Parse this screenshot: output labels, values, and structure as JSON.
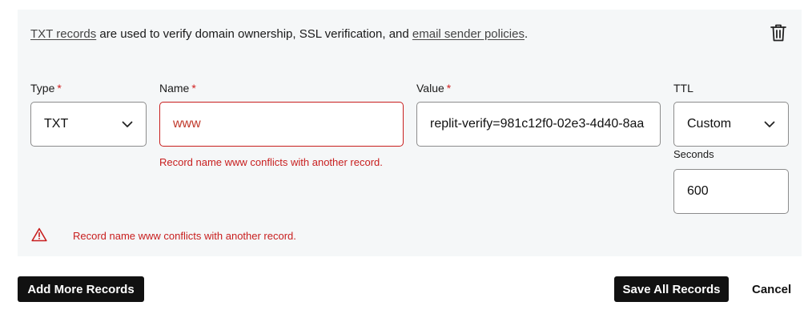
{
  "intro": {
    "link1": "TXT records",
    "middle": " are used to verify domain ownership, SSL verification, and ",
    "link2": "email sender policies",
    "end": "."
  },
  "icons": {
    "delete": "trash-icon",
    "select_arrow": "chevron-down-icon",
    "warning": "warning-triangle-icon"
  },
  "form": {
    "type": {
      "label": "Type",
      "required_mark": "*",
      "value": "TXT"
    },
    "name": {
      "label": "Name",
      "required_mark": "*",
      "value": "www",
      "error": "Record name www conflicts with another record."
    },
    "value": {
      "label": "Value",
      "required_mark": "*",
      "value": "replit-verify=981c12f0-02e3-4d40-8aa"
    },
    "ttl": {
      "label": "TTL",
      "value": "Custom"
    },
    "seconds": {
      "label": "Seconds",
      "value": "600"
    }
  },
  "form_error": "Record name www conflicts with another record.",
  "actions": {
    "add_more": "Add More Records",
    "save_all": "Save All Records",
    "cancel": "Cancel"
  },
  "colors": {
    "panel_bg": "#f5f7f8",
    "error": "#c81e1e",
    "button_bg": "#111111",
    "required": "#d11f1f"
  }
}
